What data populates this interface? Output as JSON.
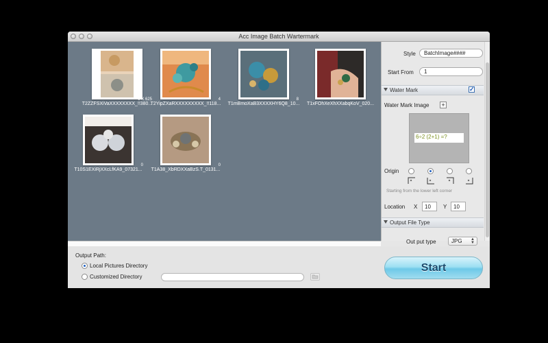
{
  "window": {
    "title": "Acc Image Batch Wartermark"
  },
  "gallery": {
    "items": [
      {
        "caption": "T2ZZFSXiVaXXXXXXXX_!!380...",
        "dims": "5 X 625"
      },
      {
        "caption": "T2YipZXaRXXXXXXXXX_!!118...",
        "dims": "4"
      },
      {
        "caption": "T1mBmoXaB3XXXXHY6Q8_10...",
        "dims": "8"
      },
      {
        "caption": "T1xFOhXeXhXXabqKoV_020...",
        "dims": ""
      },
      {
        "caption": "T10S1EXiRjXXcLfKA9_07321...",
        "dims": "0"
      },
      {
        "caption": "T1A38_XbRDXXaBzS.T_0131...",
        "dims": "0"
      }
    ]
  },
  "settings": {
    "style_label": "Style",
    "style_value": "BatchImage####",
    "start_from_label": "Start From",
    "start_from_value": "1",
    "watermark_section": "Water Mark",
    "watermark_checked": true,
    "watermark_image_label": "Water Mark Image",
    "watermark_preview_text": "6÷2 (2+1) =?",
    "origin_label": "Origin",
    "origin_selected_index": 1,
    "origin_hint": "Starting from the lower left corner",
    "location_label": "Location",
    "x_label": "X",
    "x_value": "10",
    "y_label": "Y",
    "y_value": "10",
    "output_section": "Output File Type",
    "output_type_label": "Out put type",
    "output_type_value": "JPG"
  },
  "output": {
    "path_label": "Output Path:",
    "local_label": "Local Pictures Directory",
    "custom_label": "Customized Directory",
    "selected": "local",
    "path_value": ""
  },
  "start_label": "Start",
  "colors": {
    "gallery_bg": "#6c7a87",
    "start_button": "#9ddff2"
  }
}
